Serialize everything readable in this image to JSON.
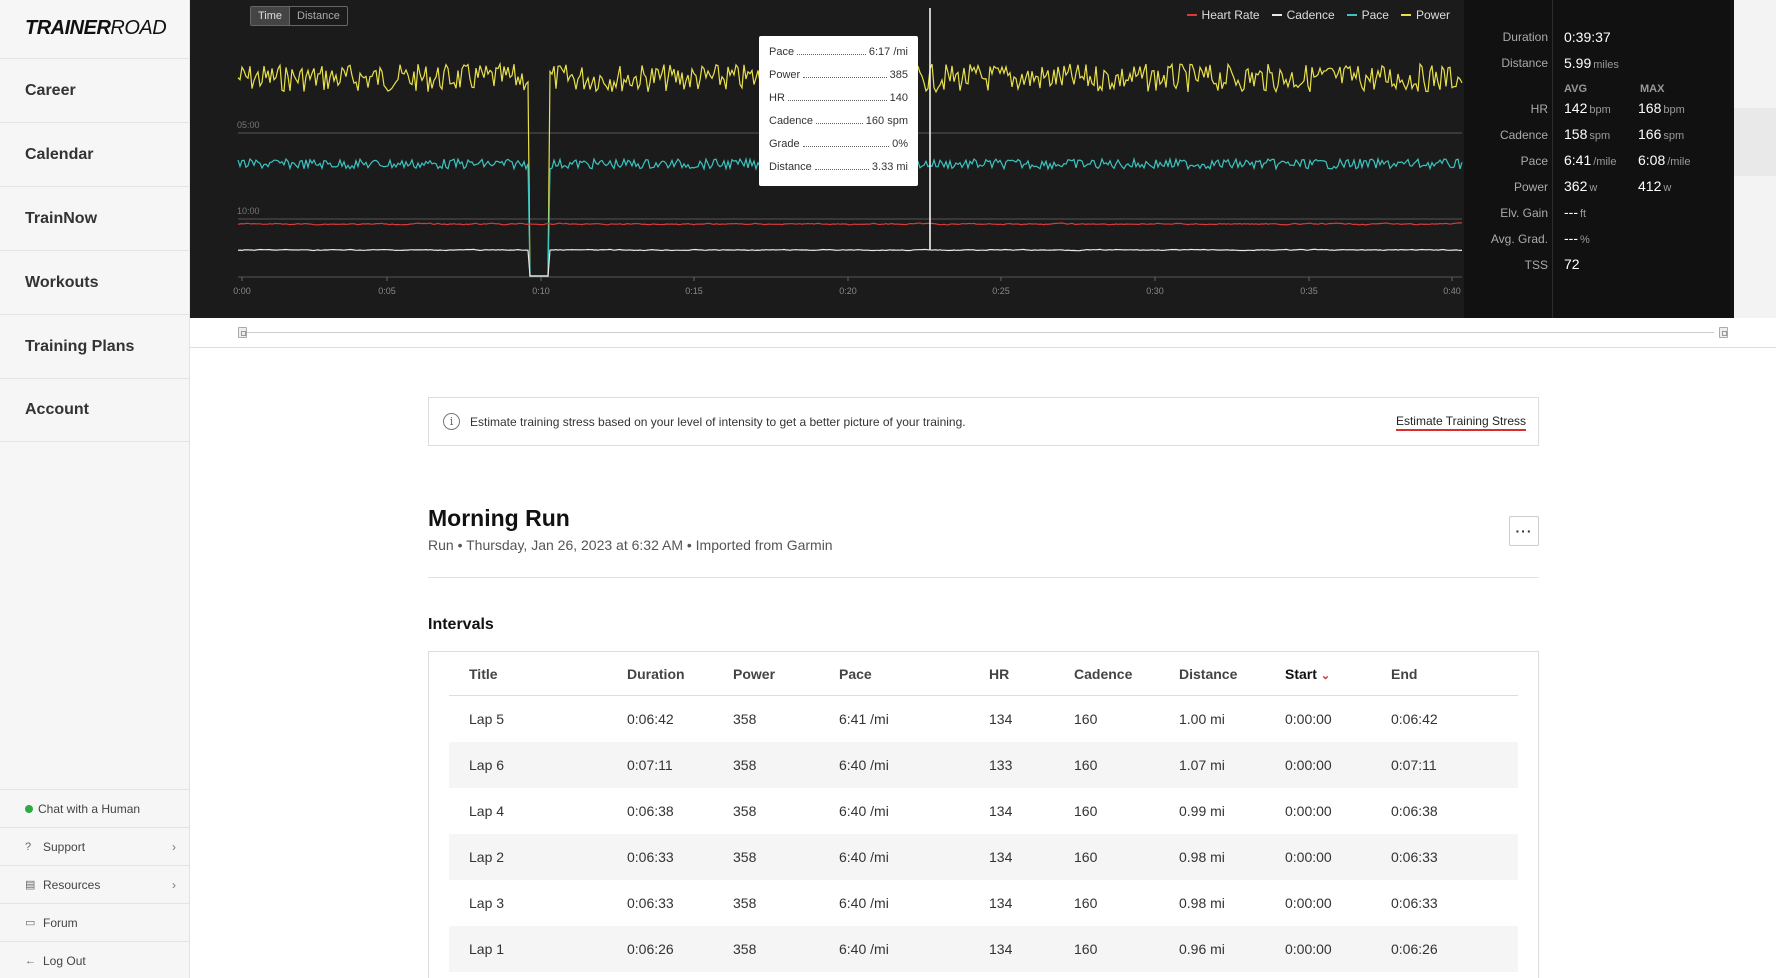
{
  "sidebar": {
    "logo_bold": "TRAINER",
    "logo_light": "ROAD",
    "nav": [
      {
        "label": "Career"
      },
      {
        "label": "Calendar"
      },
      {
        "label": "TrainNow"
      },
      {
        "label": "Workouts"
      },
      {
        "label": "Training Plans"
      },
      {
        "label": "Account"
      }
    ],
    "bottom": {
      "chat": "Chat with a Human",
      "support": "Support",
      "resources": "Resources",
      "forum": "Forum",
      "logout": "Log Out"
    }
  },
  "chart": {
    "toggle": {
      "time": "Time",
      "distance": "Distance"
    },
    "legend": [
      {
        "name": "Heart Rate",
        "color": "#d93a3a"
      },
      {
        "name": "Cadence",
        "color": "#e8e8e8"
      },
      {
        "name": "Pace",
        "color": "#3bc4c0"
      },
      {
        "name": "Power",
        "color": "#e8e04a"
      }
    ],
    "grid_labels": [
      "05:00",
      "10:00"
    ],
    "x_ticks": [
      "0:00",
      "0:05",
      "0:10",
      "0:15",
      "0:20",
      "0:25",
      "0:30",
      "0:35",
      "0:40"
    ],
    "tooltip": [
      {
        "label": "Pace",
        "value": "6:17 /mi"
      },
      {
        "label": "Power",
        "value": "385"
      },
      {
        "label": "HR",
        "value": "140"
      },
      {
        "label": "Cadence",
        "value": "160 spm"
      },
      {
        "label": "Grade",
        "value": "0%"
      },
      {
        "label": "Distance",
        "value": "3.33 mi"
      }
    ]
  },
  "stats": {
    "duration_label": "Duration",
    "duration": "0:39:37",
    "distance_label": "Distance",
    "distance": "5.99",
    "distance_unit": "miles",
    "avg_head": "AVG",
    "max_head": "MAX",
    "rows": [
      {
        "label": "HR",
        "avg": "142",
        "avg_unit": "bpm",
        "max": "168",
        "max_unit": "bpm"
      },
      {
        "label": "Cadence",
        "avg": "158",
        "avg_unit": "spm",
        "max": "166",
        "max_unit": "spm"
      },
      {
        "label": "Pace",
        "avg": "6:41",
        "avg_unit": "/mile",
        "max": "6:08",
        "max_unit": "/mile"
      },
      {
        "label": "Power",
        "avg": "362",
        "avg_unit": "w",
        "max": "412",
        "max_unit": "w"
      },
      {
        "label": "Elv. Gain",
        "avg": "---",
        "avg_unit": "ft",
        "max": "",
        "max_unit": ""
      },
      {
        "label": "Avg. Grad.",
        "avg": "---",
        "avg_unit": "%",
        "max": "",
        "max_unit": ""
      },
      {
        "label": "TSS",
        "avg": "72",
        "avg_unit": "",
        "max": "",
        "max_unit": ""
      }
    ]
  },
  "banner": {
    "info_icon": "i",
    "text": "Estimate training stress based on your level of intensity to get a better picture of your training.",
    "link": "Estimate Training Stress"
  },
  "activity": {
    "title": "Morning Run",
    "subtitle": "Run • Thursday, Jan 26, 2023 at 6:32 AM • Imported from Garmin",
    "more": "···"
  },
  "intervals": {
    "title": "Intervals",
    "columns": [
      "Title",
      "Duration",
      "Power",
      "Pace",
      "HR",
      "Cadence",
      "Distance",
      "Start",
      "End"
    ],
    "rows": [
      [
        "Lap 5",
        "0:06:42",
        "358",
        "6:41 /mi",
        "134",
        "160",
        "1.00 mi",
        "0:00:00",
        "0:06:42"
      ],
      [
        "Lap 6",
        "0:07:11",
        "358",
        "6:40 /mi",
        "133",
        "160",
        "1.07 mi",
        "0:00:00",
        "0:07:11"
      ],
      [
        "Lap 4",
        "0:06:38",
        "358",
        "6:40 /mi",
        "134",
        "160",
        "0.99 mi",
        "0:00:00",
        "0:06:38"
      ],
      [
        "Lap 2",
        "0:06:33",
        "358",
        "6:40 /mi",
        "134",
        "160",
        "0.98 mi",
        "0:00:00",
        "0:06:33"
      ],
      [
        "Lap 3",
        "0:06:33",
        "358",
        "6:40 /mi",
        "134",
        "160",
        "0.98 mi",
        "0:00:00",
        "0:06:33"
      ],
      [
        "Lap 1",
        "0:06:26",
        "358",
        "6:40 /mi",
        "134",
        "160",
        "0.96 mi",
        "0:00:00",
        "0:06:26"
      ]
    ]
  }
}
